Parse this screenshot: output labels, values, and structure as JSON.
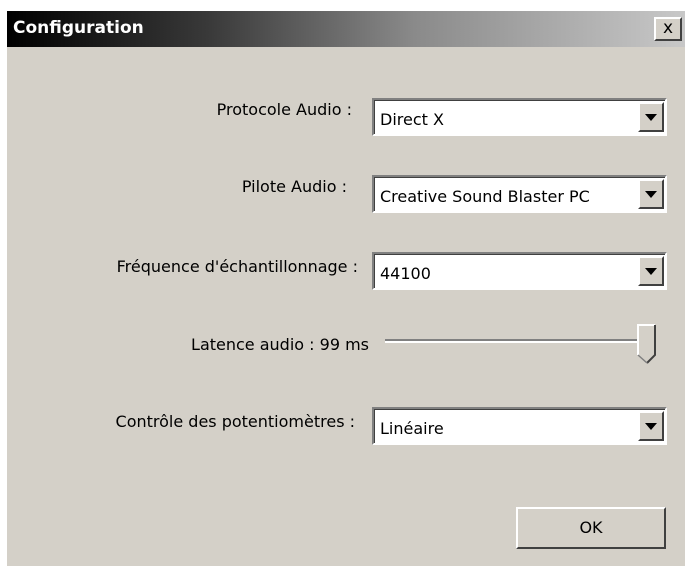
{
  "window": {
    "title": "Configuration",
    "close_glyph": "x"
  },
  "fields": {
    "protocol": {
      "label": "Protocole Audio :",
      "value": "Direct X"
    },
    "driver": {
      "label": "Pilote Audio :",
      "value": "Creative Sound Blaster PC"
    },
    "sample_rate": {
      "label": "Fréquence d'échantillonnage :",
      "value": "44100"
    },
    "latency": {
      "label": "Latence audio : 99 ms",
      "slider_level": 1.0
    },
    "pot_control": {
      "label": "Contrôle des potentiomètres :",
      "value": "Linéaire"
    }
  },
  "buttons": {
    "ok_label": "OK"
  }
}
